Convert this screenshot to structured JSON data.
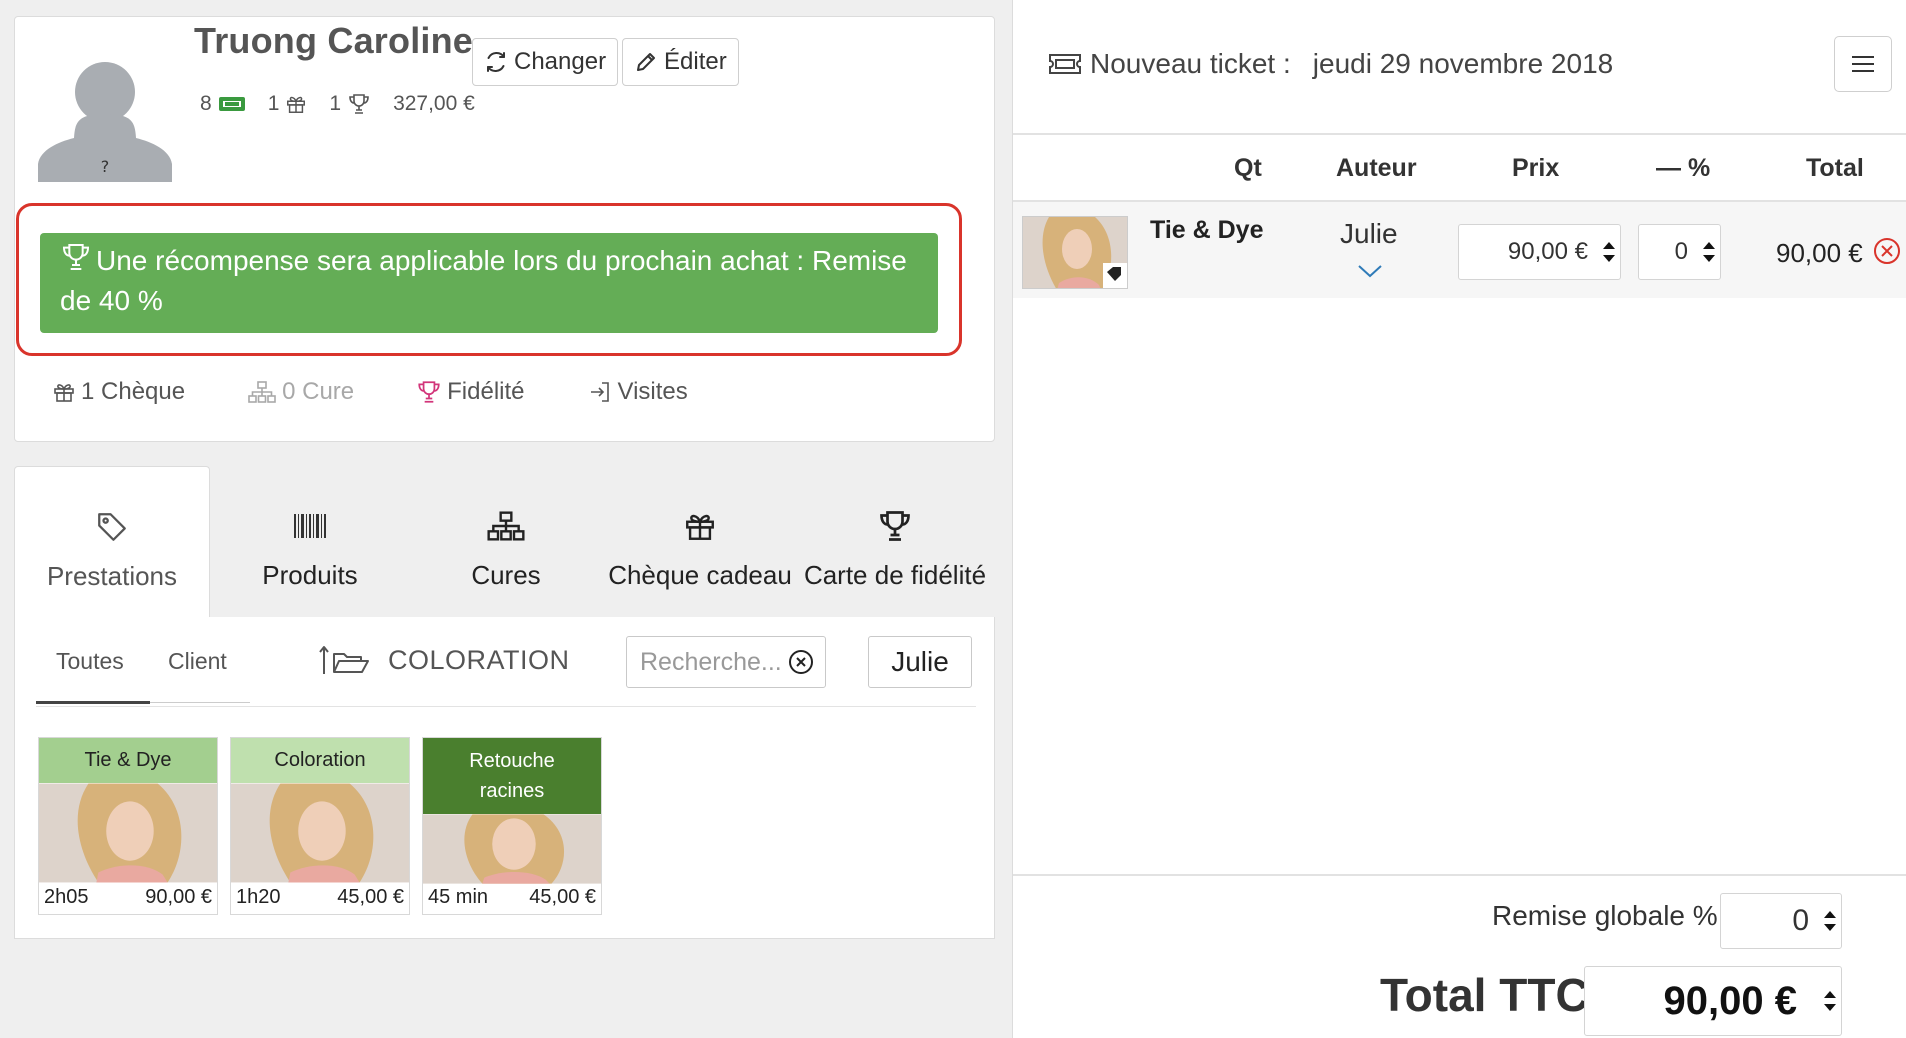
{
  "client": {
    "name": "Truong Caroline",
    "change_label": "Changer",
    "edit_label": "Éditer",
    "stats": {
      "tickets": "8",
      "gifts": "1",
      "rewards": "1",
      "amount": "327,00 €"
    },
    "reward_message": "Une récompense sera applicable lors du prochain achat : Remise de  40 %",
    "links": {
      "cheque": "1 Chèque",
      "cure": "0 Cure",
      "fidelite": "Fidélité",
      "visites": "Visites"
    }
  },
  "tabs": [
    {
      "label": "Prestations",
      "icon": "tag-icon"
    },
    {
      "label": "Produits",
      "icon": "barcode-icon"
    },
    {
      "label": "Cures",
      "icon": "sitemap-icon"
    },
    {
      "label": "Chèque cadeau",
      "icon": "gift-icon"
    },
    {
      "label": "Carte de fidélité",
      "icon": "trophy-icon"
    }
  ],
  "catalog": {
    "filters": {
      "all": "Toutes",
      "client": "Client"
    },
    "category": "COLORATION",
    "search_placeholder": "Recherche...",
    "employee": "Julie",
    "items": [
      {
        "name": "Tie & Dye",
        "duration": "2h05",
        "price": "90,00 €",
        "color": "#a3cf8f",
        "text_color": "#222222"
      },
      {
        "name": "Coloration",
        "duration": "1h20",
        "price": "45,00 €",
        "color": "#bfe0ae",
        "text_color": "#222222"
      },
      {
        "name": "Retouche racines",
        "duration": "45 min",
        "price": "45,00 €",
        "color": "#4a7f2e",
        "text_color": "#ffffff"
      }
    ]
  },
  "ticket": {
    "title": "Nouveau ticket :",
    "date": "jeudi 29 novembre 2018",
    "columns": {
      "qt": "Qt",
      "auteur": "Auteur",
      "prix": "Prix",
      "remise": "— %",
      "total": "Total"
    },
    "lines": [
      {
        "name": "Tie & Dye",
        "author": "Julie",
        "price": "90,00 €",
        "discount": "0",
        "total": "90,00 €"
      }
    ],
    "global_discount_label": "Remise globale %",
    "global_discount": "0",
    "total_label": "Total TTC",
    "total": "90,00 €"
  },
  "colors": {
    "reward_green": "#64ad56",
    "alert_red": "#d9342b",
    "fidelite_pink": "#d2357a",
    "link_blue": "#2f7bb8"
  }
}
